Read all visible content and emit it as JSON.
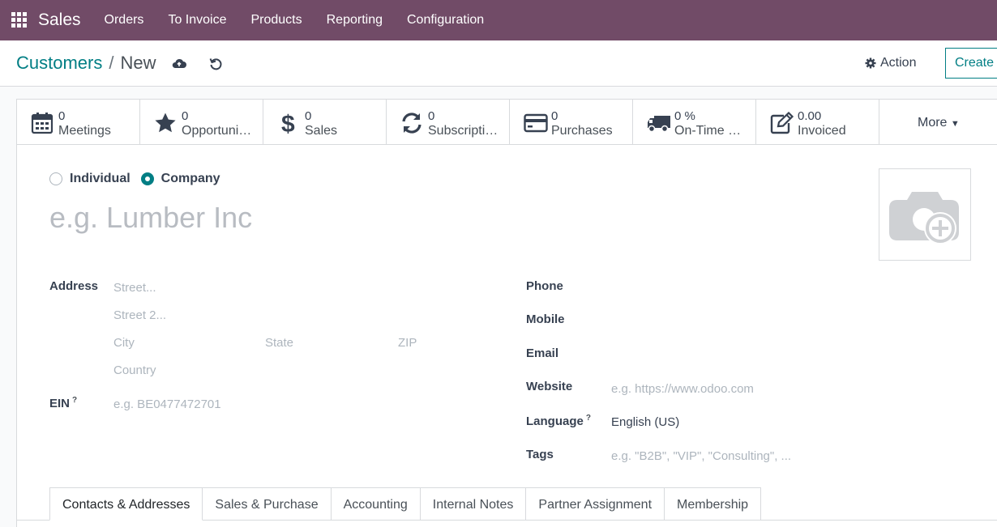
{
  "navbar": {
    "brand": "Sales",
    "menu": [
      "Orders",
      "To Invoice",
      "Products",
      "Reporting",
      "Configuration"
    ]
  },
  "breadcrumb": {
    "parent": "Customers",
    "separator": "/",
    "current": "New"
  },
  "toolbar": {
    "action_label": "Action",
    "create_label": "Create"
  },
  "stats": [
    {
      "num": "0",
      "label": "Meetings",
      "icon": "calendar-icon"
    },
    {
      "num": "0",
      "label": "Opportunities",
      "icon": "star-icon"
    },
    {
      "num": "0",
      "label": "Sales",
      "icon": "dollar-icon"
    },
    {
      "num": "0",
      "label": "Subscriptions",
      "icon": "refresh-icon"
    },
    {
      "num": "0",
      "label": "Purchases",
      "icon": "credit-card-icon"
    },
    {
      "num": "0 %",
      "label": "On-Time Rate",
      "icon": "truck-icon"
    },
    {
      "num": "0.00",
      "label": "Invoiced",
      "icon": "edit-icon"
    }
  ],
  "more_label": "More",
  "type": {
    "individual": "Individual",
    "company": "Company",
    "selected": "Company"
  },
  "name_placeholder": "e.g. Lumber Inc",
  "address": {
    "label": "Address",
    "street_ph": "Street...",
    "street2_ph": "Street 2...",
    "city_ph": "City",
    "state_ph": "State",
    "zip_ph": "ZIP",
    "country_ph": "Country"
  },
  "ein": {
    "label": "EIN",
    "help": "?",
    "placeholder": "e.g. BE0477472701"
  },
  "phone_label": "Phone",
  "mobile_label": "Mobile",
  "email_label": "Email",
  "website": {
    "label": "Website",
    "placeholder": "e.g. https://www.odoo.com"
  },
  "language": {
    "label": "Language",
    "help": "?",
    "value": "English (US)"
  },
  "tags": {
    "label": "Tags",
    "placeholder": "e.g. \"B2B\", \"VIP\", \"Consulting\", ..."
  },
  "tabs": [
    "Contacts & Addresses",
    "Sales & Purchase",
    "Accounting",
    "Internal Notes",
    "Partner Assignment",
    "Membership"
  ]
}
